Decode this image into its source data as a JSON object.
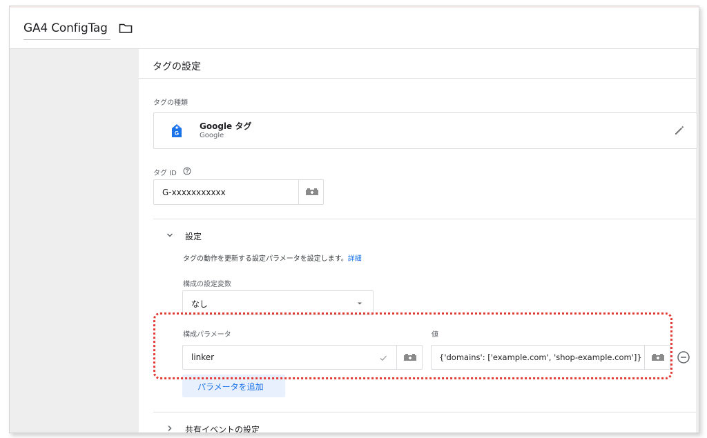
{
  "header": {
    "tag_name": "GA4 ConfigTag"
  },
  "tag_config": {
    "title": "タグの設定",
    "tag_type_label": "タグの種類",
    "tag_type": {
      "name": "Google タグ",
      "vendor": "Google"
    },
    "tag_id_label": "タグ ID",
    "tag_id_value": "G-xxxxxxxxxxx"
  },
  "settings": {
    "title": "設定",
    "description": "タグの動作を更新する設定パラメータを設定します。",
    "details_link": "詳細",
    "config_var_label": "構成の設定変数",
    "config_var_value": "なし",
    "param_label": "構成パラメータ",
    "value_label": "値",
    "param_name": "linker",
    "param_value": "{'domains': ['example.com', 'shop-example.com']}",
    "add_param_button": "パラメータを追加"
  },
  "shared_event": {
    "title": "共有イベントの設定"
  },
  "colors": {
    "accent": "#1a73e8",
    "highlight": "#e53935",
    "sidebar": "#eeeeee"
  }
}
